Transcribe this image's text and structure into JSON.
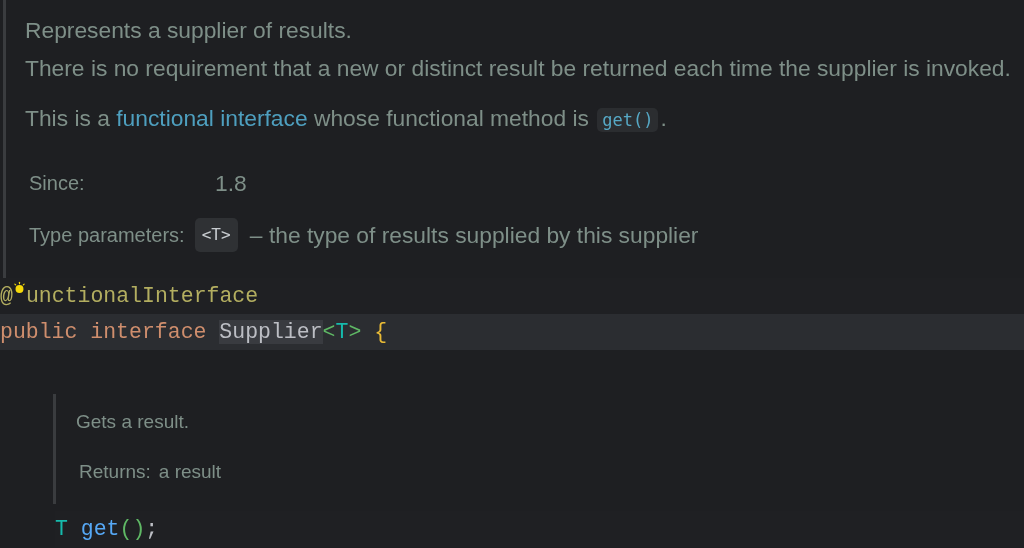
{
  "class_doc": {
    "paragraphs": [
      [
        {
          "kind": "text",
          "text": "Represents a supplier of results."
        }
      ],
      [
        {
          "kind": "text",
          "text": "There is no requirement that a new or distinct result be returned each time the supplier is invoked."
        }
      ],
      [
        {
          "kind": "text",
          "text": "This is a "
        },
        {
          "kind": "link",
          "text": "functional interface"
        },
        {
          "kind": "text",
          "text": " whose functional method is "
        },
        {
          "kind": "code",
          "text": "get()"
        },
        {
          "kind": "text",
          "text": "."
        }
      ]
    ],
    "tags": [
      {
        "label": "Since:",
        "value": [
          {
            "kind": "text",
            "text": "1.8"
          }
        ]
      },
      {
        "label": "Type parameters:",
        "value": [
          {
            "kind": "chip",
            "text": "<T>"
          },
          {
            "kind": "text",
            "text": " – the type of results supplied by this supplier"
          }
        ]
      }
    ]
  },
  "code_lines": [
    {
      "current": false,
      "bulb": true,
      "tokens": [
        {
          "kind": "annotation",
          "text": "@"
        },
        {
          "kind": "annotation",
          "text": "unctionalInterface"
        }
      ]
    },
    {
      "current": true,
      "tokens": [
        {
          "kind": "keyword",
          "text": "public interface "
        },
        {
          "kind": "class",
          "text": "Supplier"
        },
        {
          "kind": "bracket",
          "text": "<"
        },
        {
          "kind": "typeparam",
          "text": "T"
        },
        {
          "kind": "bracket",
          "text": ">"
        },
        {
          "kind": "brace",
          "text": " {"
        }
      ]
    }
  ],
  "method_doc": {
    "paragraphs": [
      "Gets a result."
    ],
    "tags": [
      {
        "label": "Returns:",
        "value": "a result"
      }
    ]
  },
  "method_line": {
    "tokens": [
      {
        "kind": "typeparam",
        "text": "T"
      },
      {
        "kind": "method",
        "text": " get"
      },
      {
        "kind": "bracket",
        "text": "()"
      },
      {
        "kind": "punct",
        "text": ";"
      }
    ]
  }
}
